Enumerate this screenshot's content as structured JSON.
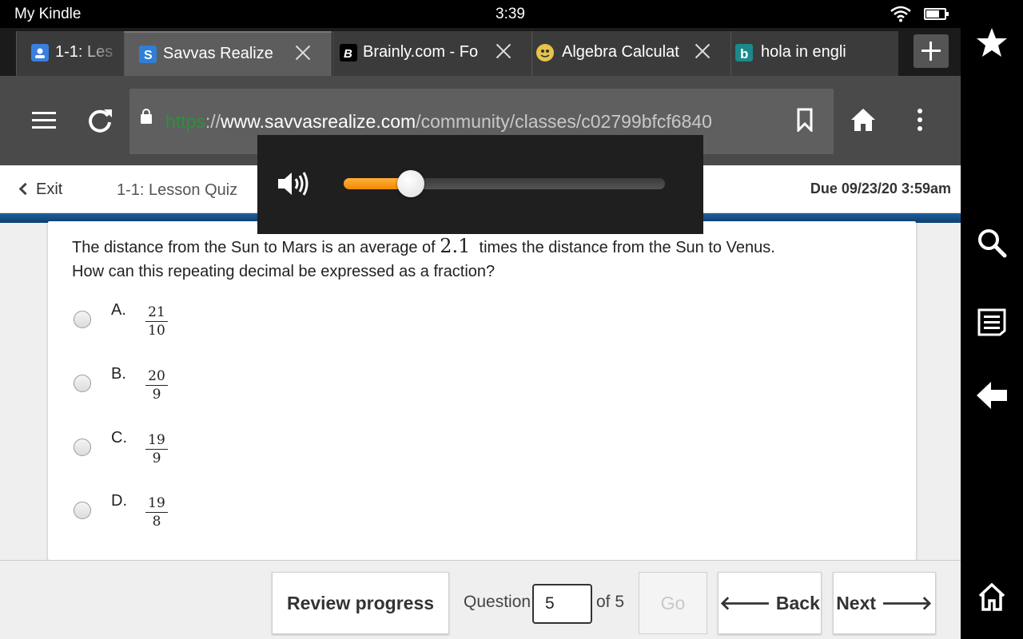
{
  "status": {
    "app_name": "My Kindle",
    "time": "3:39"
  },
  "tabs": [
    {
      "title": "1-1: Les",
      "icon": "classroom-icon",
      "color": "#3b7fe0",
      "active": false
    },
    {
      "title": "Savvas Realize",
      "icon": "savvas-icon",
      "color": "#2f7fd6",
      "active": true
    },
    {
      "title": "Brainly.com - Fo",
      "icon": "brainly-icon",
      "color": "#000000",
      "active": false
    },
    {
      "title": "Algebra Calculat",
      "icon": "calculator-icon",
      "color": "#e8c34a",
      "active": false
    },
    {
      "title": "hola in engli",
      "icon": "bing-icon",
      "color": "#1a8a8a",
      "active": false
    }
  ],
  "toolbar": {
    "url_scheme": "https",
    "url_sep": "://",
    "url_domain": "www.savvasrealize.com",
    "url_path": "/community/classes/c02799bfcf6840"
  },
  "volume": {
    "level": 0.16
  },
  "quiz": {
    "exit_label": "Exit",
    "title": "1-1: Lesson Quiz",
    "due": "Due 09/23/20 3:59am"
  },
  "question": {
    "text_before": "The distance from the Sun to Mars is an average of",
    "number": "2.1",
    "text_after": "times the distance from the Sun to Venus.",
    "line2": "How can this repeating decimal be expressed as a fraction?"
  },
  "choices": [
    {
      "letter": "A.",
      "numerator": "21",
      "denominator": "10"
    },
    {
      "letter": "B.",
      "numerator": "20",
      "denominator": "9"
    },
    {
      "letter": "C.",
      "numerator": "19",
      "denominator": "9"
    },
    {
      "letter": "D.",
      "numerator": "19",
      "denominator": "8"
    }
  ],
  "footer": {
    "review_label": "Review progress",
    "question_label": "Question",
    "question_value": "5",
    "of_label": "of 5",
    "go_label": "Go",
    "back_label": "Back",
    "next_label": "Next"
  },
  "side_panel": [
    "favorites-star-icon",
    "search-icon",
    "reading-list-icon",
    "back-arrow-icon",
    "home-icon"
  ],
  "colors": {
    "accent_orange": "#f08a00",
    "quiz_stripe": "#1f5f9c",
    "url_scheme_green": "#2f8f3f"
  }
}
